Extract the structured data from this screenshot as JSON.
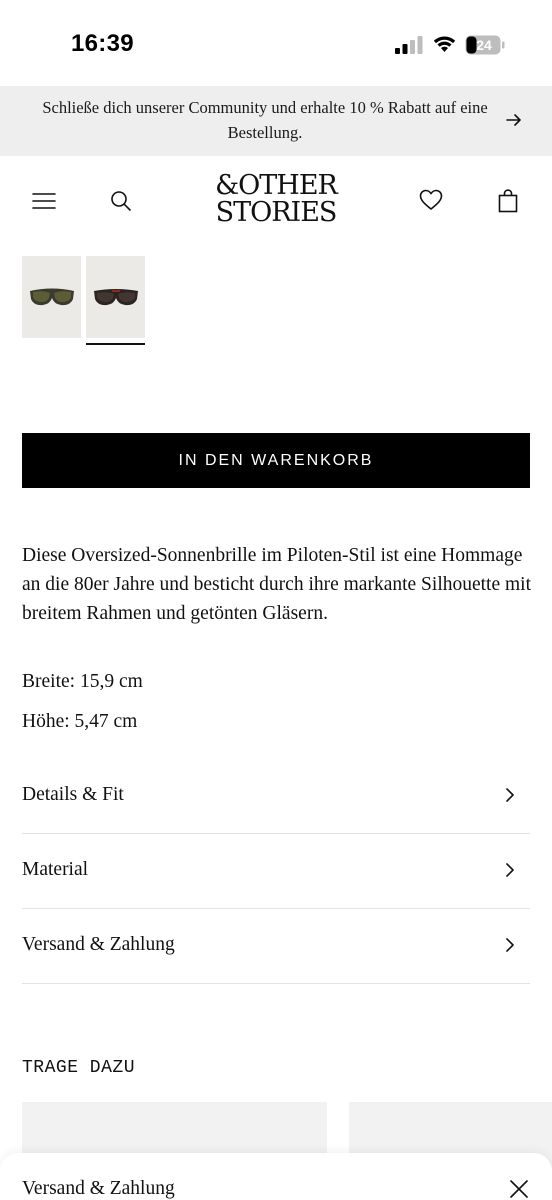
{
  "status_bar": {
    "time": "16:39",
    "battery": "24"
  },
  "promo": {
    "text": "Schließe dich unserer Community und erhalte 10 % Rabatt auf eine Bestellung."
  },
  "header": {
    "logo_line1": "&OTHER",
    "logo_line2": "STORIES"
  },
  "product": {
    "cart_button": "IN DEN WARENKORB",
    "description": "Diese Oversized-Sonnenbrille im Piloten-Stil ist eine Hommage an die 80er Jahre und besticht durch ihre markante Silhouette mit breitem Rahmen und getönten Gläsern.",
    "width": "Breite: 15,9 cm",
    "height": "Höhe: 5,47 cm"
  },
  "accordion": [
    {
      "label": "Details & Fit"
    },
    {
      "label": "Material"
    },
    {
      "label": "Versand & Zahlung"
    }
  ],
  "wear_with": {
    "title": "TRAGE DAZU"
  },
  "sheet": {
    "title": "Versand & Zahlung"
  },
  "icons": {
    "menu": "hamburger-menu-icon",
    "search": "search-icon",
    "wishlist": "heart-icon",
    "bag": "shopping-bag-icon",
    "promo_arrow": "arrow-right-icon",
    "chevron": "chevron-right-icon",
    "close": "close-icon"
  }
}
